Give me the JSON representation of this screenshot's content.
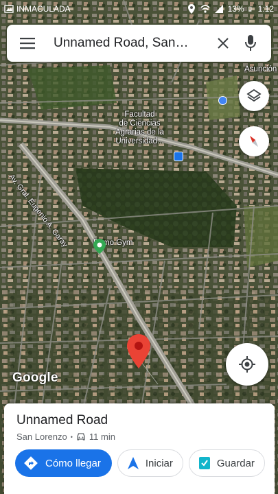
{
  "status_bar": {
    "carrier": "INMACULADA",
    "battery": "13%",
    "time": "1:12"
  },
  "search": {
    "query": "Unnamed Road, San…"
  },
  "map": {
    "labels": {
      "facultad": "Facultad\nde Ciencias\nAgrarias de la\nUniversidad...",
      "avenue": "Av. Gral. Eugenio A. Garay",
      "gym": "Ritmo Gym",
      "asuncion": "Asunción"
    },
    "attribution": "Google"
  },
  "place": {
    "title": "Unnamed Road",
    "locality": "San Lorenzo",
    "drive_time": "11 min"
  },
  "actions": {
    "directions": "Cómo llegar",
    "start": "Iniciar",
    "save": "Guardar"
  },
  "colors": {
    "primary": "#1a73e8",
    "pin": "#ea4335",
    "gym_pin": "#34a853"
  }
}
